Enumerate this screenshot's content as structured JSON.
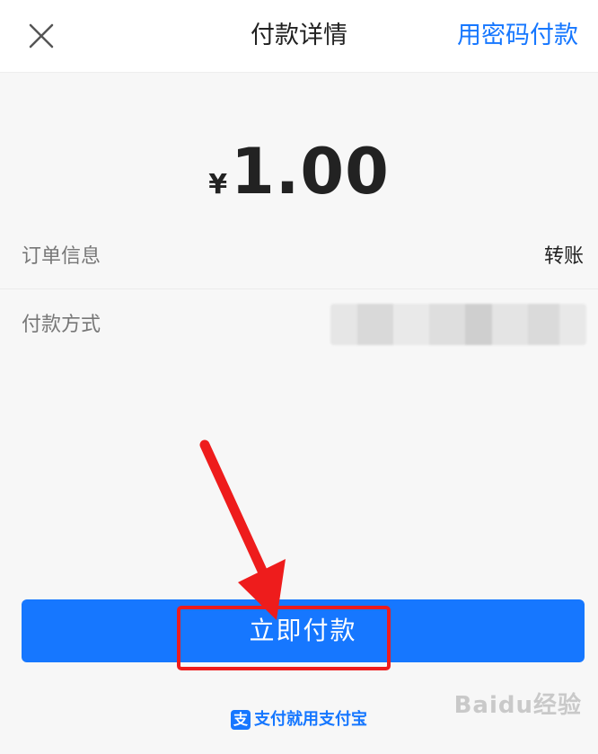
{
  "header": {
    "title": "付款详情",
    "action_label": "用密码付款"
  },
  "amount": {
    "currency": "¥",
    "value": "1.00"
  },
  "rows": [
    {
      "label": "订单信息",
      "value": "转账"
    },
    {
      "label": "付款方式",
      "value": ""
    }
  ],
  "pay_button": {
    "label": "立即付款"
  },
  "footer": {
    "logo_glyph": "支",
    "text": "支付就用支付宝"
  },
  "watermark": {
    "text": "Baidu经验"
  },
  "colors": {
    "accent": "#1677ff",
    "annotation": "#ee1c1c"
  }
}
